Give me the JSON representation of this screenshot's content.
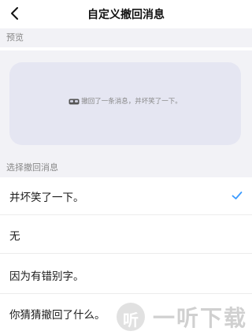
{
  "header": {
    "title": "自定义撤回消息",
    "back_icon": "chevron-left-icon"
  },
  "preview": {
    "section_label": "预览",
    "message_text": "撤回了一条消息，并坏笑了一下。",
    "icon": "recall-glasses-icon"
  },
  "options_section": {
    "section_label": "选择撤回消息",
    "items": [
      {
        "label": "并坏笑了一下。",
        "selected": true
      },
      {
        "label": "无",
        "selected": false
      },
      {
        "label": "因为有错别字。",
        "selected": false
      },
      {
        "label": "你猜猜撤回了什么。",
        "selected": false
      }
    ],
    "check_color": "#3b9bff"
  },
  "watermark": {
    "badge_glyph": "听",
    "text": "一听下载"
  }
}
